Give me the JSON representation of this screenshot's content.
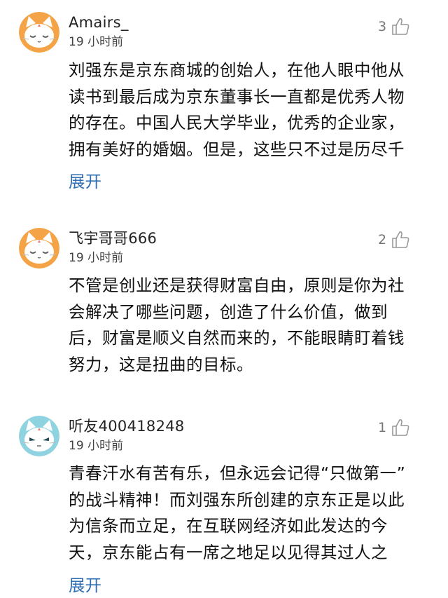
{
  "comments": [
    {
      "username": "Amairs_",
      "time": "19 小时前",
      "likes": "3",
      "avatar_icon": "cat-avatar-icon",
      "avatar_color": "#f4a347",
      "lines": [
        "刘强东是京东商城的创始人，在他人眼中他从",
        "读书到最后成为京东董事长一直都是优秀人物",
        "的存在。中国人民大学毕业，优秀的企业家，",
        "拥有美好的婚姻。但是，这些只不过是历尽千"
      ],
      "expand_label": "展开"
    },
    {
      "username": "飞宇哥哥666",
      "time": "19 小时前",
      "likes": "2",
      "avatar_icon": "cat-avatar-icon",
      "avatar_color": "#f4a347",
      "lines": [
        "不管是创业还是获得财富自由，原则是你为社",
        "会解决了哪些问题，创造了什么价值，做到",
        "后，财富是顺义自然而来的，不能眼睛盯着钱",
        "努力，这是扭曲的目标。"
      ]
    },
    {
      "username": "听友400418248",
      "time": "19 小时前",
      "likes": "1",
      "avatar_icon": "cat-avatar-icon",
      "avatar_color": "#8fd3e0",
      "lines": [
        "青春汗水有苦有乐，但永远会记得“只做第一”",
        "的战斗精神！而刘强东所创建的京东正是以此",
        "为信条而立足，在互联网经济如此发达的今",
        "天，京东能占有一席之地足以见得其过人之"
      ],
      "expand_label": "展开"
    }
  ],
  "colors": {
    "expand_link": "#2f6db5",
    "like_icon": "#999999"
  }
}
